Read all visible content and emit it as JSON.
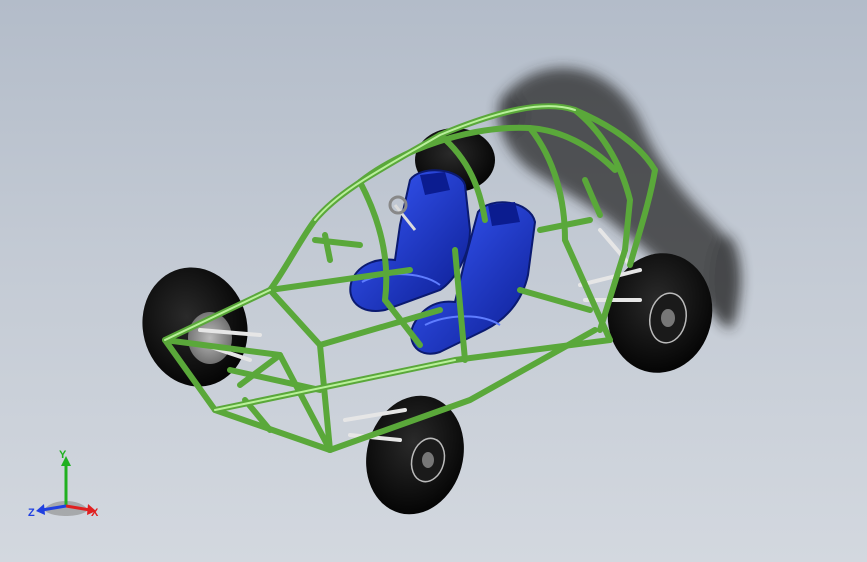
{
  "viewport": {
    "model": "buggy-assembly"
  },
  "triad": {
    "x_label": "X",
    "y_label": "Y",
    "z_label": "Z",
    "x_color": "#e02020",
    "y_color": "#20b020",
    "z_color": "#2040e0"
  },
  "colors": {
    "frame": "#7ccf5a",
    "frame_dark": "#3f8a2a",
    "seat": "#1a3ad8",
    "seat_dark": "#0d1f80",
    "tire": "#0e0e0e",
    "suspension": "#e8e8e8",
    "shadow": "#2a2a2a"
  }
}
